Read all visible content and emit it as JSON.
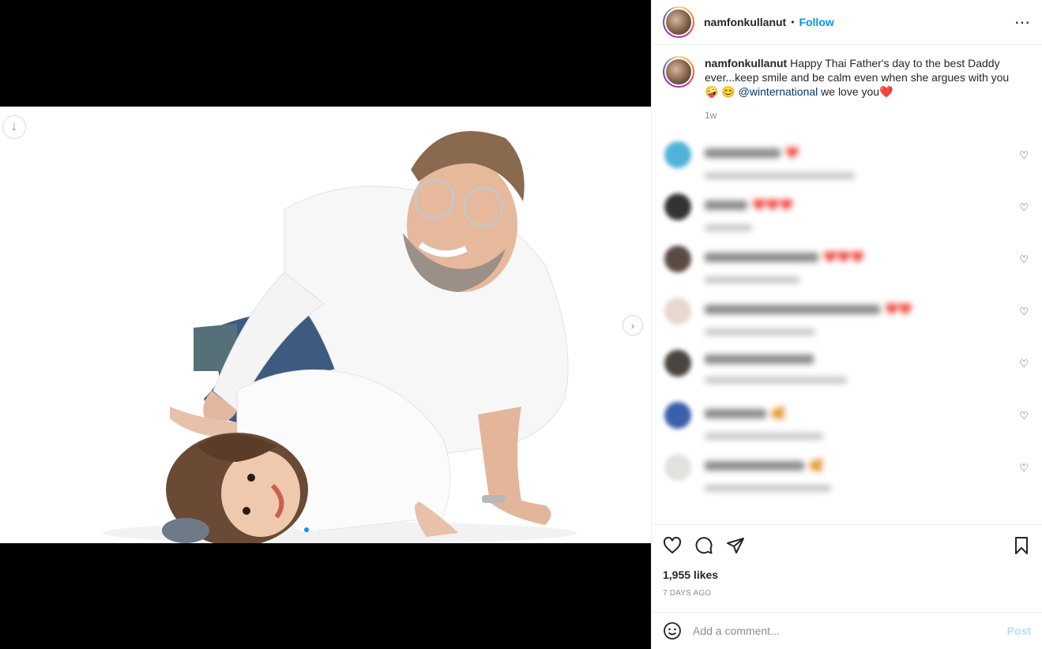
{
  "post": {
    "username": "namfonkullanut",
    "separator": "•",
    "follow_label": "Follow",
    "more_icon": "more-horizontal-icon"
  },
  "caption": {
    "username": "namfonkullanut",
    "text_part1": " Happy Thai Father's day to the best Daddy ever...keep smile and be calm even when she argues with you",
    "emoji1": "🤪",
    "emoji2": "😊",
    "mention": "@winternational",
    "text_part2": " we love you",
    "emoji3": "❤️",
    "time": "1w"
  },
  "comments": [
    {
      "avatar_color": "#4fb3d9",
      "hearts": "❤️"
    },
    {
      "avatar_color": "#333333",
      "hearts": "❤️❤️❤️"
    },
    {
      "avatar_color": "#5a4a44",
      "hearts": "❤️❤️❤️"
    },
    {
      "avatar_color": "#e8d6d0",
      "hearts": "❤️❤️"
    },
    {
      "avatar_color": "#4a4540",
      "hearts": ""
    },
    {
      "avatar_color": "#3b5fa8",
      "hearts": "🥰"
    },
    {
      "avatar_color": "#dfe3dc",
      "hearts": "🥰"
    }
  ],
  "actions": {
    "likes": "1,955 likes",
    "posted": "7 DAYS AGO"
  },
  "comment_box": {
    "placeholder": "Add a comment...",
    "post_label": "Post"
  },
  "colors": {
    "accent": "#0095f6",
    "post_disabled": "#b2dffc",
    "mention": "#00376b"
  }
}
